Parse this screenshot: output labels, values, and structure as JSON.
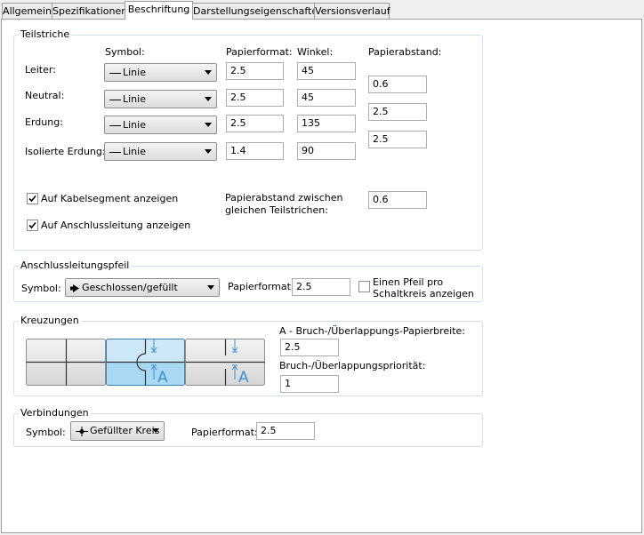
{
  "tabs": [
    {
      "label": "Allgemein"
    },
    {
      "label": "Spezifikationen"
    },
    {
      "label": "Beschriftung"
    },
    {
      "label": "Darstellungseigenschaften"
    },
    {
      "label": "Versionsverlauf"
    }
  ],
  "teilstriche": {
    "title": "Teilstriche",
    "headers": {
      "symbol": "Symbol:",
      "papierformat": "Papierformat:",
      "winkel": "Winkel:",
      "papierabstand": "Papierabstand:"
    },
    "rows": [
      {
        "label": "Leiter:",
        "symbol": "Linie",
        "papierformat": "2.5",
        "winkel": "45"
      },
      {
        "label": "Neutral:",
        "symbol": "Linie",
        "papierformat": "2.5",
        "winkel": "45"
      },
      {
        "label": "Erdung:",
        "symbol": "Linie",
        "papierformat": "2.5",
        "winkel": "135"
      },
      {
        "label": "Isolierte Erdung:",
        "symbol": "Linie",
        "papierformat": "1.4",
        "winkel": "90"
      }
    ],
    "papierabstand_values": [
      "0.6",
      "2.5",
      "2.5"
    ],
    "chk_kabelsegment": {
      "label": "Auf Kabelsegment anzeigen",
      "checked": true
    },
    "chk_anschlussleitung": {
      "label": "Auf Anschlussleitung anzeigen",
      "checked": true
    },
    "abstand_gleich_label_1": "Papierabstand zwischen",
    "abstand_gleich_label_2": "gleichen Teilstrichen:",
    "abstand_gleich_value": "0.6"
  },
  "pfeil": {
    "title": "Anschlussleitungspfeil",
    "symbol_label": "Symbol:",
    "symbol_value": "Geschlossen/gefüllt",
    "papierformat_label": "Papierformat:",
    "papierformat_value": "2.5",
    "chk_label_1": "Einen Pfeil pro",
    "chk_label_2": "Schaltkreis anzeigen",
    "chk_checked": false
  },
  "kreuzungen": {
    "title": "Kreuzungen",
    "options": [
      "none",
      "bridge",
      "break"
    ],
    "selected": "bridge",
    "tile_letter": "A",
    "breite_label": "A - Bruch-/Überlappungs-Papierbreite:",
    "breite_value": "2.5",
    "prioritaet_label": "Bruch-/Überlappungspriorität:",
    "prioritaet_value": "1"
  },
  "verbindungen": {
    "title": "Verbindungen",
    "symbol_label": "Symbol:",
    "symbol_value": "Gefüllter Kreis",
    "papierformat_label": "Papierformat:",
    "papierformat_value": "2.5"
  },
  "colors": {
    "accent_blue": "#3c8fd8",
    "tile_selected": "#cde8f7",
    "group_border": "#d5dfe5"
  }
}
